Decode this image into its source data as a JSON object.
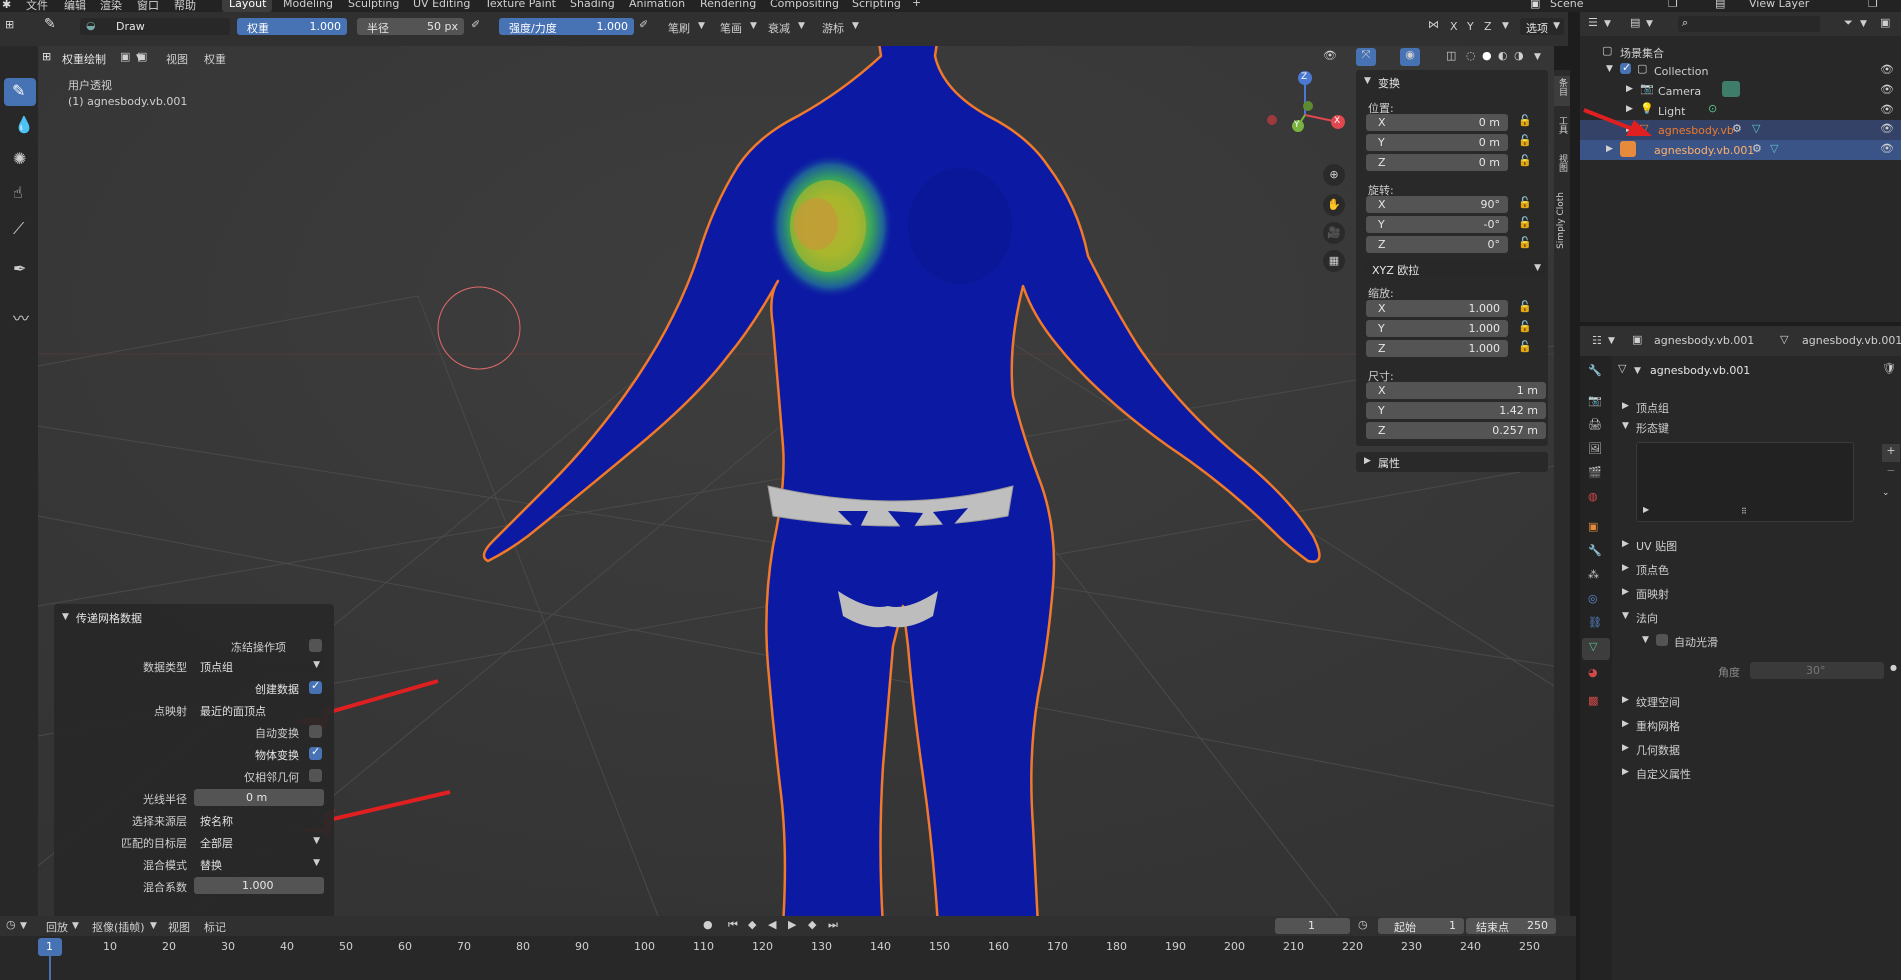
{
  "topbar": {
    "menus": [
      "文件",
      "编辑",
      "渲染",
      "窗口",
      "帮助"
    ],
    "workspaces": [
      "Layout",
      "Modeling",
      "Sculpting",
      "UV Editing",
      "Texture Paint",
      "Shading",
      "Animation",
      "Rendering",
      "Compositing",
      "Scripting"
    ],
    "active_workspace": "Layout",
    "scene": "Scene",
    "view_layer": "View Layer"
  },
  "tool_header": {
    "brush_name": "Draw",
    "weight_label": "权重",
    "weight_value": "1.000",
    "radius_label": "半径",
    "radius_value": "50 px",
    "strength_label": "强度/力度",
    "strength_value": "1.000",
    "brush_menu": "笔刷",
    "stroke_menu": "笔画",
    "falloff_menu": "衰减",
    "cursor_menu": "游标",
    "axis_x": "X",
    "axis_y": "Y",
    "axis_z": "Z",
    "options_menu": "选项"
  },
  "viewport_header": {
    "mode": "权重绘制",
    "view_menu": "视图",
    "weights_menu": "权重"
  },
  "viewport": {
    "view_name": "用户透视",
    "object_name": "(1) agnesbody.vb.001",
    "gizmo_x": "X",
    "gizmo_y": "Y",
    "gizmo_z": "Z"
  },
  "transform_panel": {
    "title": "变换",
    "location_label": "位置:",
    "location": [
      {
        "axis": "X",
        "value": "0 m"
      },
      {
        "axis": "Y",
        "value": "0 m"
      },
      {
        "axis": "Z",
        "value": "0 m"
      }
    ],
    "rotation_label": "旋转:",
    "rotation": [
      {
        "axis": "X",
        "value": "90°"
      },
      {
        "axis": "Y",
        "value": "-0°"
      },
      {
        "axis": "Z",
        "value": "0°"
      }
    ],
    "rotation_mode": "XYZ 欧拉",
    "scale_label": "缩放:",
    "scale": [
      {
        "axis": "X",
        "value": "1.000"
      },
      {
        "axis": "Y",
        "value": "1.000"
      },
      {
        "axis": "Z",
        "value": "1.000"
      }
    ],
    "dimensions_label": "尺寸:",
    "dimensions": [
      {
        "axis": "X",
        "value": "1 m"
      },
      {
        "axis": "Y",
        "value": "1.42 m"
      },
      {
        "axis": "Z",
        "value": "0.257 m"
      }
    ],
    "properties_title": "属性"
  },
  "side_tabs": [
    "条目",
    "工具",
    "视图",
    "Simply Cloth"
  ],
  "operator_panel": {
    "title": "传递网格数据",
    "freeze_label": "冻结操作项",
    "data_type_label": "数据类型",
    "data_type_value": "顶点组",
    "create_data_label": "创建数据",
    "vertex_mapping_label": "点映射",
    "vertex_mapping_value": "最近的面顶点",
    "auto_transform_label": "自动变换",
    "object_transform_label": "物体变换",
    "only_neighbor_label": "仅相邻几何",
    "ray_radius_label": "光线半径",
    "ray_radius_value": "0 m",
    "source_layers_label": "选择来源层",
    "source_layers_value": "按名称",
    "dest_layers_label": "匹配的目标层",
    "dest_layers_value": "全部层",
    "mix_mode_label": "混合模式",
    "mix_mode_value": "替换",
    "mix_factor_label": "混合系数",
    "mix_factor_value": "1.000"
  },
  "outliner": {
    "root": "场景集合",
    "items": [
      {
        "name": "Collection"
      },
      {
        "name": "Camera"
      },
      {
        "name": "Light"
      },
      {
        "name": "agnesbody.vb"
      },
      {
        "name": "agnesbody.vb.001"
      }
    ]
  },
  "properties": {
    "breadcrumb_object": "agnesbody.vb.001",
    "breadcrumb_data": "agnesbody.vb.001",
    "mesh_name": "agnesbody.vb.001",
    "sections": [
      "顶点组",
      "形态键",
      "UV 贴图",
      "顶点色",
      "面映射",
      "法向",
      "纹理空间",
      "重构网格",
      "几何数据",
      "自定义属性"
    ],
    "auto_smooth_label": "自动光滑",
    "angle_label": "角度",
    "angle_value": "30°"
  },
  "timeline": {
    "playback_menu": "回放",
    "keying_menu": "抠像(插帧)",
    "view_menu": "视图",
    "marker_menu": "标记",
    "current_frame": "1",
    "start_label": "起始",
    "start_value": "1",
    "end_label": "结束点",
    "end_value": "250",
    "ruler": [
      "1",
      "10",
      "20",
      "30",
      "40",
      "50",
      "60",
      "70",
      "80",
      "90",
      "100",
      "110",
      "120",
      "130",
      "140",
      "150",
      "160",
      "170",
      "180",
      "190",
      "200",
      "210",
      "220",
      "230",
      "240",
      "250"
    ]
  },
  "colors": {
    "accent": "#4772b3",
    "selection_orange": "#f0792b",
    "mesh_blue": "#0c1aa3"
  }
}
